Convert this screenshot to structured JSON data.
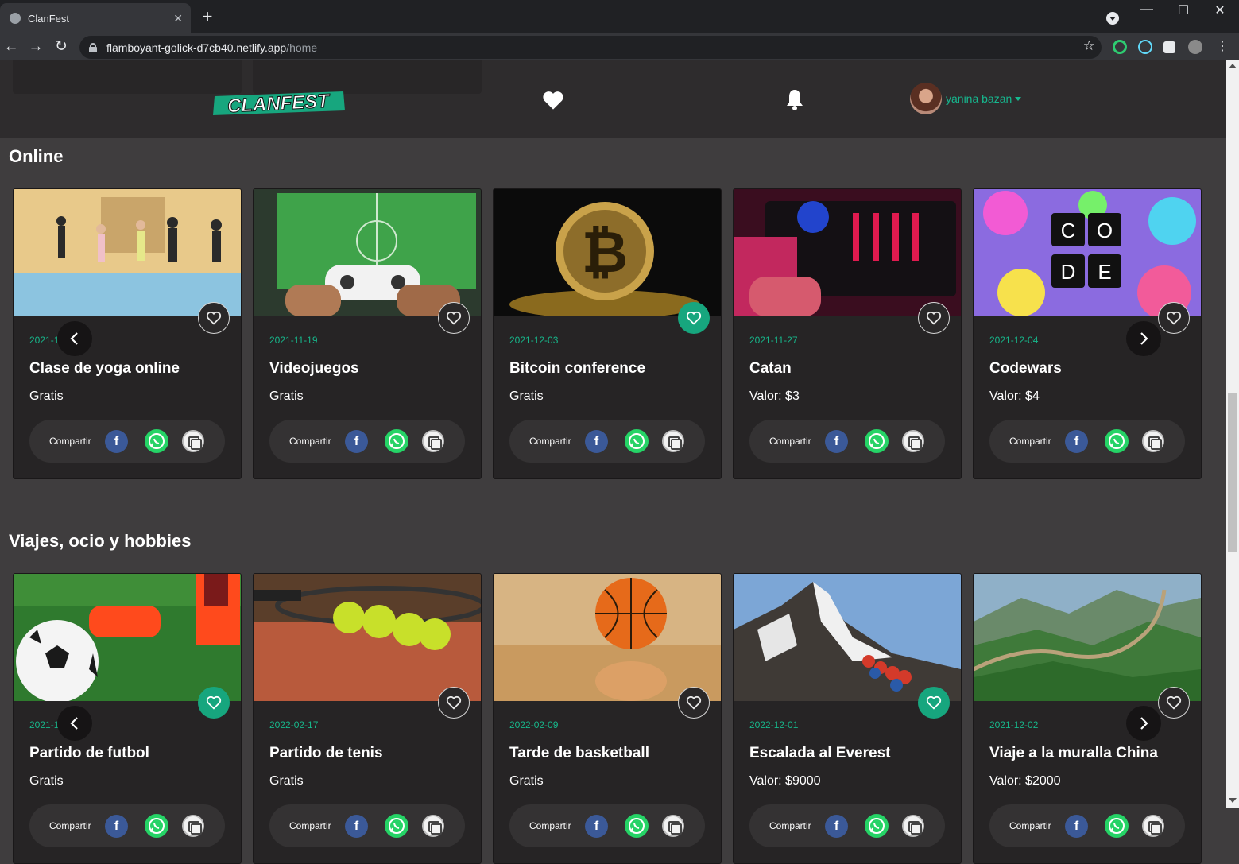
{
  "browser": {
    "tab_title": "ClanFest",
    "tab_close": "✕",
    "new_tab": "+",
    "url_host": "flamboyant-golick-d7cb40.netlify.app",
    "url_path": "/home",
    "controls": {
      "minimize": "—",
      "maximize": "☐",
      "close": "✕"
    },
    "nav": {
      "back": "←",
      "forward": "→",
      "reload": "↻"
    },
    "star": "☆"
  },
  "header": {
    "logo_text": "CLANFEST",
    "user_name": "yanina bazan"
  },
  "sections": [
    {
      "title": "Online",
      "cards": [
        {
          "date": "2021-11-26",
          "name": "Clase de yoga online",
          "price": "Gratis",
          "favorite": false,
          "share_label": "Compartir",
          "image": "yoga-class"
        },
        {
          "date": "2021-11-19",
          "name": "Videojuegos",
          "price": "Gratis",
          "favorite": false,
          "share_label": "Compartir",
          "image": "videogame-controller"
        },
        {
          "date": "2021-12-03",
          "name": "Bitcoin conference",
          "price": "Gratis",
          "favorite": true,
          "share_label": "Compartir",
          "image": "bitcoin"
        },
        {
          "date": "2021-11-27",
          "name": "Catan",
          "price": "Valor: $3",
          "favorite": false,
          "share_label": "Compartir",
          "image": "dj-mixer"
        },
        {
          "date": "2021-12-04",
          "name": "Codewars",
          "price": "Valor: $4",
          "favorite": false,
          "share_label": "Compartir",
          "image": "code-paint"
        }
      ]
    },
    {
      "title": "Viajes, ocio y hobbies",
      "cards": [
        {
          "date": "2021-11-20",
          "name": "Partido de futbol",
          "price": "Gratis",
          "favorite": true,
          "share_label": "Compartir",
          "image": "soccer-ball"
        },
        {
          "date": "2022-02-17",
          "name": "Partido de tenis",
          "price": "Gratis",
          "favorite": false,
          "share_label": "Compartir",
          "image": "tennis-balls"
        },
        {
          "date": "2022-02-09",
          "name": "Tarde de basketball",
          "price": "Gratis",
          "favorite": false,
          "share_label": "Compartir",
          "image": "basketball"
        },
        {
          "date": "2022-12-01",
          "name": "Escalada al Everest",
          "price": "Valor: $9000",
          "favorite": true,
          "share_label": "Compartir",
          "image": "everest-climbers"
        },
        {
          "date": "2021-12-02",
          "name": "Viaje a la muralla China",
          "price": "Valor: $2000",
          "favorite": false,
          "share_label": "Compartir",
          "image": "great-wall"
        }
      ]
    }
  ],
  "colors": {
    "accent": "#17b68a",
    "background": "#3f3d3e",
    "card": "#262425",
    "header": "#2e2c2d",
    "facebook": "#3b5998",
    "whatsapp": "#25d366"
  }
}
